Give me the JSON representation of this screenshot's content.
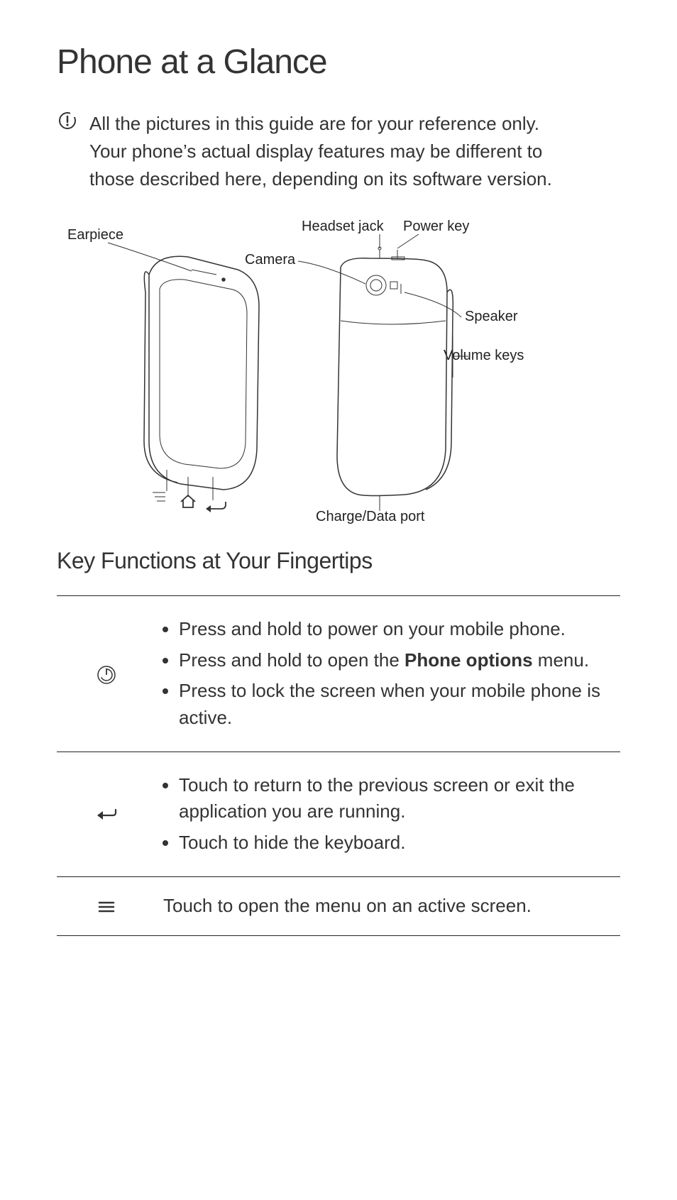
{
  "title": "Phone at a Glance",
  "note": "All the pictures in this guide are for your reference only. Your phone’s actual display features may be different to those described here, depending on its software version.",
  "diagram": {
    "labels": {
      "earpiece": "Earpiece",
      "camera": "Camera",
      "headset_jack": "Headset jack",
      "power_key": "Power key",
      "speaker": "Speaker",
      "volume_keys": "Volume keys",
      "charge_port": "Charge/Data port"
    }
  },
  "subtitle": "Key Functions at Your Fingertips",
  "rows": [
    {
      "icon": "power",
      "items": [
        {
          "pre": "Press and hold to power on your mobile phone.",
          "bold": "",
          "post": ""
        },
        {
          "pre": "Press and hold to open the ",
          "bold": "Phone options",
          "post": " menu."
        },
        {
          "pre": "Press to lock the screen when your mobile phone is active.",
          "bold": "",
          "post": ""
        }
      ]
    },
    {
      "icon": "back",
      "items": [
        {
          "pre": "Touch to return to the previous screen or exit the application you are running.",
          "bold": "",
          "post": ""
        },
        {
          "pre": "Touch to hide the keyboard.",
          "bold": "",
          "post": ""
        }
      ]
    },
    {
      "icon": "menu",
      "text": "Touch to open the menu on an active screen."
    }
  ]
}
